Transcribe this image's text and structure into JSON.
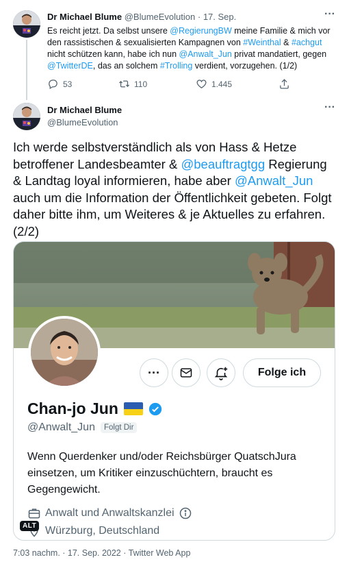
{
  "tweet1": {
    "author_name": "Dr Michael Blume",
    "author_handle": "@BlumeEvolution",
    "separator": " · ",
    "date": "17. Sep.",
    "body": [
      {
        "t": "Es reicht jetzt. Da selbst unsere ",
        "link": false
      },
      {
        "t": "@RegierungBW",
        "link": true
      },
      {
        "t": " meine Familie & mich vor den rassistischen & sexualisierten Kampagnen von ",
        "link": false
      },
      {
        "t": "#Weinthal",
        "link": true
      },
      {
        "t": " & ",
        "link": false
      },
      {
        "t": "#achgut",
        "link": true
      },
      {
        "t": " nicht schützen kann, habe ich nun ",
        "link": false
      },
      {
        "t": "@Anwalt_Jun",
        "link": true
      },
      {
        "t": " privat mandatiert, gegen ",
        "link": false
      },
      {
        "t": "@TwitterDE",
        "link": true
      },
      {
        "t": ", das an solchem ",
        "link": false
      },
      {
        "t": "#Trolling",
        "link": true
      },
      {
        "t": " verdient, vorzugehen. (1/2)",
        "link": false
      }
    ],
    "replies": "53",
    "retweets": "110",
    "likes": "1.445"
  },
  "tweet2": {
    "author_name": "Dr Michael Blume",
    "author_handle": "@BlumeEvolution",
    "body": [
      {
        "t": "Ich werde selbstverständlich als von Hass & Hetze betroffener Landesbeamter & ",
        "link": false
      },
      {
        "t": "@beauftragtgg",
        "link": true
      },
      {
        "t": " Regierung & Landtag loyal informieren, habe aber ",
        "link": false
      },
      {
        "t": "@Anwalt_Jun",
        "link": true
      },
      {
        "t": " auch um die Information der Öffentlichkeit gebeten. Folgt daher bitte ihm, um Weiteres & je Aktuelles zu erfahren. (2/2)",
        "link": false
      }
    ],
    "timestamp": "7:03 nachm. · 17. Sep. 2022 · Twitter Web App"
  },
  "profile_card": {
    "follow_label": "Folge ich",
    "name": "Chan-jo Jun",
    "handle": "@Anwalt_Jun",
    "follows_you": "Folgt Dir",
    "bio": "Wenn Querdenker und/oder Reichsbürger QuatschJura einsetzen, um Kritiker einzuschüchtern, braucht es Gegengewicht.",
    "category": "Anwalt und Anwaltskanzlei",
    "location": "Würzburg, Deutschland",
    "alt_badge": "ALT"
  },
  "icons": {
    "more": "more-horizontal-icon",
    "reply": "reply-icon",
    "retweet": "retweet-icon",
    "like": "heart-icon",
    "share": "share-icon",
    "message": "envelope-icon",
    "notify": "bell-plus-icon",
    "verified": "verified-badge-icon",
    "flag": "ukraine-flag-icon",
    "briefcase": "briefcase-icon",
    "info": "info-icon",
    "location": "location-pin-icon"
  },
  "colors": {
    "link": "#1d9bf0",
    "muted": "#536471",
    "text": "#0f1419",
    "border": "#cfd9de"
  }
}
